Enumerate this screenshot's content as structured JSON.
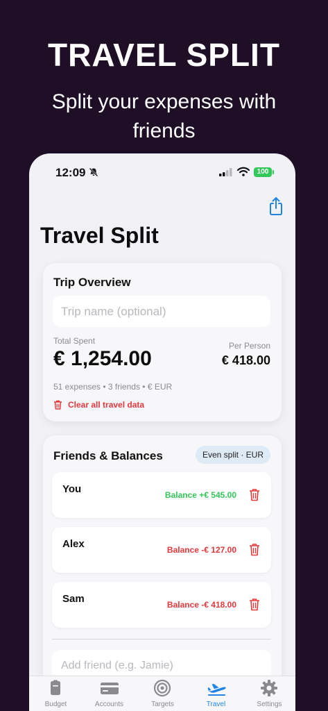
{
  "promo": {
    "title": "TRAVEL SPLIT",
    "subtitle": "Split your expenses with friends"
  },
  "status_bar": {
    "time": "12:09",
    "battery": "100"
  },
  "header": {
    "title": "Travel Split",
    "share_icon": "share-icon"
  },
  "overview": {
    "title": "Trip Overview",
    "trip_name_value": "",
    "trip_name_placeholder": "Trip name (optional)",
    "total_label": "Total Spent",
    "total_value": "€ 1,254.00",
    "per_person_label": "Per Person",
    "per_person_value": "€ 418.00",
    "meta": "51 expenses • 3 friends • € EUR",
    "clear_label": "Clear all travel data"
  },
  "friends": {
    "title": "Friends & Balances",
    "badge": "Even split · EUR",
    "items": [
      {
        "name": "You",
        "balance": "Balance +€ 545.00",
        "status": "positive"
      },
      {
        "name": "Alex",
        "balance": "Balance -€ 127.00",
        "status": "negative"
      },
      {
        "name": "Sam",
        "balance": "Balance -€ 418.00",
        "status": "negative"
      }
    ],
    "add_placeholder": "Add friend (e.g. Jamie)"
  },
  "tabs": [
    {
      "label": "Budget",
      "icon": "budget-icon",
      "active": false
    },
    {
      "label": "Accounts",
      "icon": "accounts-icon",
      "active": false
    },
    {
      "label": "Targets",
      "icon": "targets-icon",
      "active": false
    },
    {
      "label": "Travel",
      "icon": "travel-icon",
      "active": true
    },
    {
      "label": "Settings",
      "icon": "settings-icon",
      "active": false
    }
  ],
  "colors": {
    "background": "#1e0f26",
    "accent": "#1f84e3",
    "positive": "#34c759",
    "negative": "#e5383b"
  }
}
